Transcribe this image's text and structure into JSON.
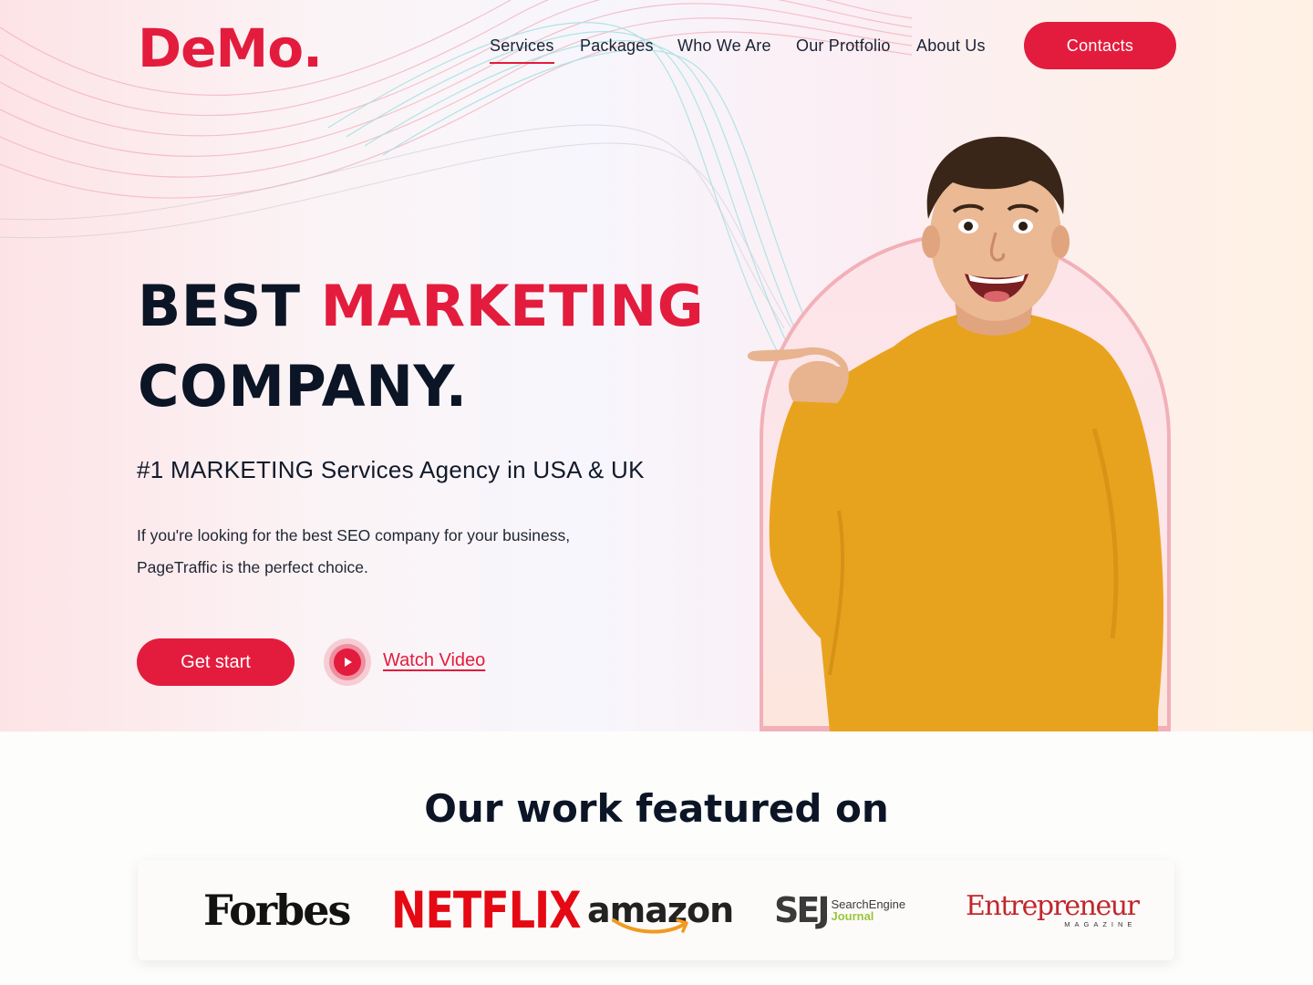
{
  "brand": {
    "logo": "DeMo.",
    "accent_color": "#e31c3d"
  },
  "nav": {
    "items": [
      {
        "label": "Services",
        "active": true
      },
      {
        "label": "Packages",
        "active": false
      },
      {
        "label": "Who We Are",
        "active": false
      },
      {
        "label": "Our Protfolio",
        "active": false
      },
      {
        "label": "About Us",
        "active": false
      }
    ],
    "cta_label": "Contacts"
  },
  "hero": {
    "headline_part1": "BEST ",
    "headline_accent": "MARKETING",
    "headline_part2": "COMPANY.",
    "subheading": "#1 MARKETING Services Agency in USA & UK",
    "description": "If you're looking for the best SEO company for your business, PageTraffic is the perfect choice.",
    "primary_button": "Get start",
    "video_link": "Watch Video",
    "image": "smiling-man-in-orange-sweater-pointing-thumb"
  },
  "featured": {
    "title": "Our work featured on",
    "logos": {
      "forbes": "Forbes",
      "netflix": "NETFLIX",
      "amazon": "amazon",
      "sej_big": "SEJ",
      "sej_line1": "SearchEngine",
      "sej_line2": "Journal",
      "entrepreneur": "Entrepreneur",
      "entrepreneur_sub": "MAGAZINE"
    }
  }
}
